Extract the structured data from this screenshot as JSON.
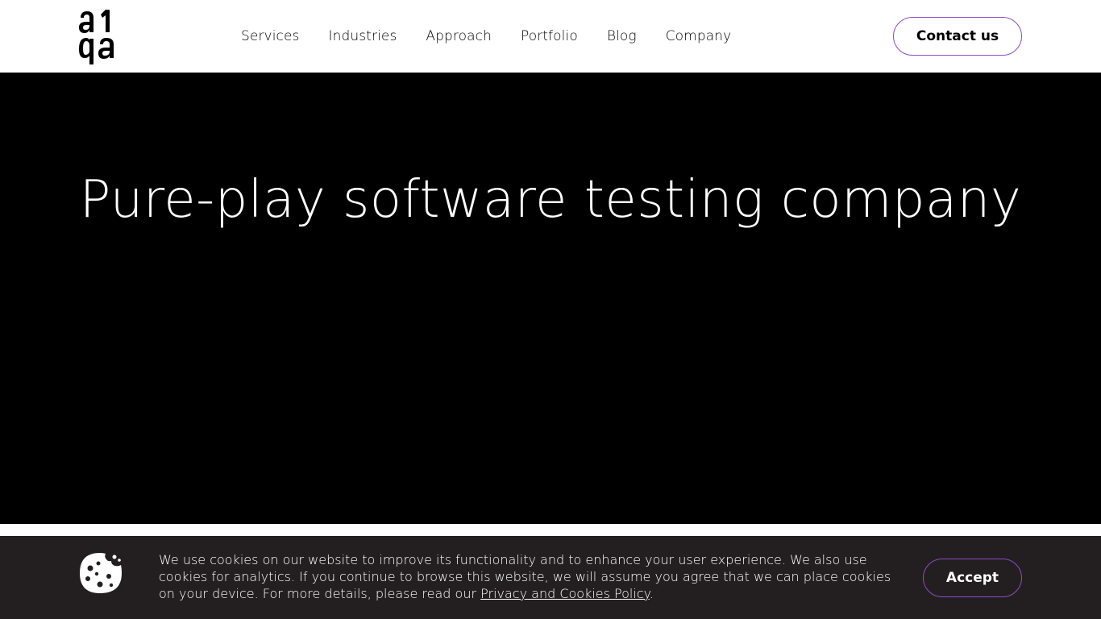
{
  "header": {
    "logo_text": "a1qa",
    "nav": [
      {
        "label": "Services"
      },
      {
        "label": "Industries"
      },
      {
        "label": "Approach"
      },
      {
        "label": "Portfolio"
      },
      {
        "label": "Blog"
      },
      {
        "label": "Company"
      }
    ],
    "contact_label": "Contact us"
  },
  "hero": {
    "title": "Pure-play software testing company"
  },
  "cookie_banner": {
    "text": "We use cookies on our website to improve its functionality and to enhance your user experience. We also use cookies for analytics. If you continue to browse this website, we will assume you agree that we can place cookies on your device. For more details, please read our ",
    "link_label": "Privacy and Cookies Policy",
    "text_end": ".",
    "accept_label": "Accept",
    "icon": "cookie-icon"
  },
  "colors": {
    "hero_bg": "#000000",
    "cookie_bg": "#231f20",
    "accent_border": "#8b4bc5"
  }
}
